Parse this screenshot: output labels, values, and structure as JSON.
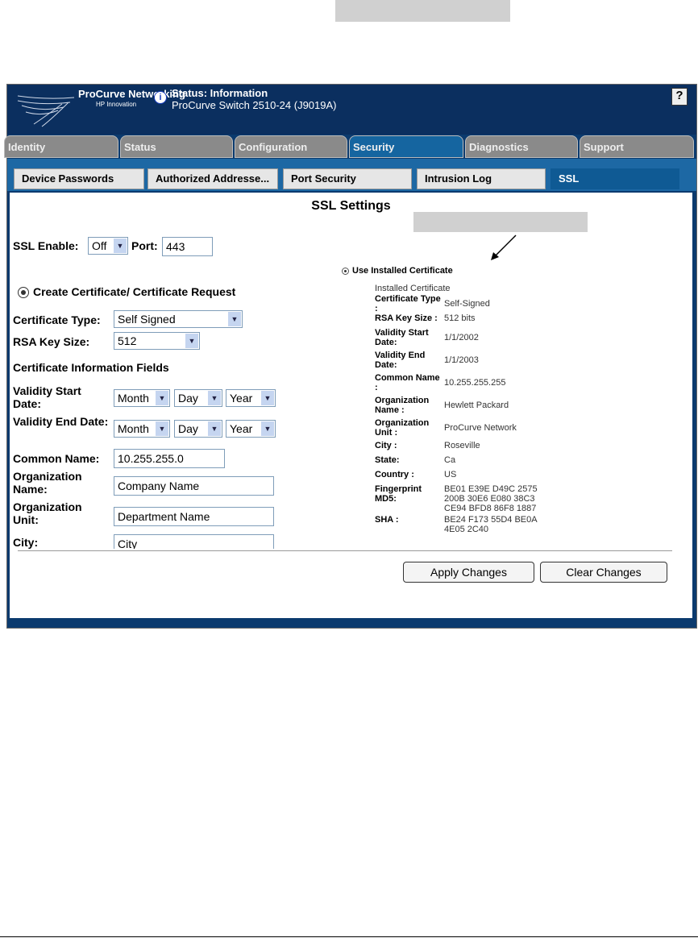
{
  "header": {
    "brand": "ProCurve Networking",
    "tagline": "HP Innovation",
    "status_title": "Status: Information",
    "status_device": "ProCurve Switch 2510-24 (J9019A)",
    "help": "?"
  },
  "tabs": [
    "Identity",
    "Status",
    "Configuration",
    "Security",
    "Diagnostics",
    "Support"
  ],
  "subtabs": [
    "Device Passwords",
    "Authorized Addresse...",
    "Port Security",
    "Intrusion Log",
    "SSL"
  ],
  "page_title": "SSL Settings",
  "left": {
    "ssl_enable_label": "SSL Enable:",
    "ssl_enable_value": "Off",
    "port_label": "Port:",
    "port_value": "443",
    "create_label": "Create Certificate/ Certificate Request",
    "cert_type_label": "Certificate Type:",
    "cert_type_value": "Self Signed",
    "rsa_label": "RSA Key Size:",
    "rsa_value": "512",
    "fields_heading": "Certificate Information Fields",
    "vstart_label": "Validity Start Date:",
    "vend_label": "Validity End Date:",
    "month": "Month",
    "day": "Day",
    "year": "Year",
    "cn_label": "Common Name:",
    "cn_value": "10.255.255.0",
    "org_label": "Organization Name:",
    "org_value": "Company Name",
    "unit_label": "Organization Unit:",
    "unit_value": "Department Name",
    "city_label": "City:",
    "city_value": "City"
  },
  "right": {
    "use_label": "Use Installed Certificate",
    "installed": "Installed Certificate",
    "rows": [
      {
        "k": "Certificate Type :",
        "v": "Self-Signed"
      },
      {
        "k": "RSA Key Size :",
        "v": "512 bits"
      },
      {
        "k": "Validity Start Date:",
        "v": "1/1/2002"
      },
      {
        "k": "Validity End Date:",
        "v": "1/1/2003"
      },
      {
        "k": "Common Name :",
        "v": "10.255.255.255"
      },
      {
        "k": "Organization Name :",
        "v": "Hewlett Packard"
      },
      {
        "k": "Organization Unit :",
        "v": "ProCurve Network"
      },
      {
        "k": "City :",
        "v": "Roseville"
      },
      {
        "k": "State:",
        "v": "Ca"
      },
      {
        "k": "Country :",
        "v": "US"
      },
      {
        "k": "Fingerprint MD5:",
        "v": "BE01 E39E D49C 2575 200B 30E6 E080 38C3 CE94 BFD8 86F8 1887"
      },
      {
        "k": "SHA :",
        "v": "BE24 F173 55D4 BE0A 4E05 2C40"
      }
    ]
  },
  "buttons": {
    "apply": "Apply Changes",
    "clear": "Clear Changes"
  }
}
